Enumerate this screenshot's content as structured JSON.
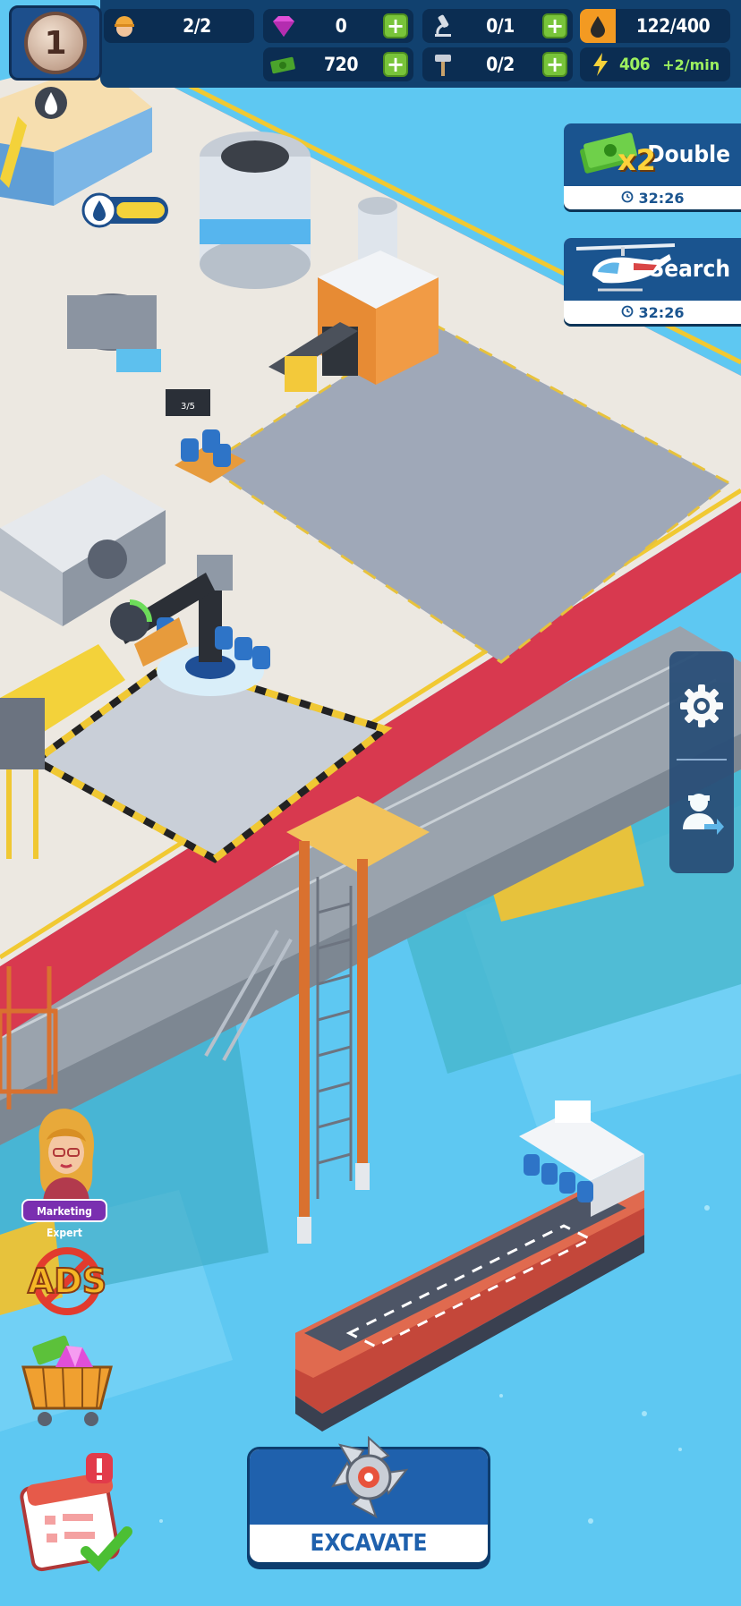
{
  "level": "1",
  "resources": {
    "workers": "2/2",
    "gems": "0",
    "research": "0/1",
    "oil": "122/400",
    "cash": "720",
    "tools": "0/2",
    "energy": "406",
    "energy_rate": "+2/min"
  },
  "boosts": {
    "double": {
      "badge": "x2",
      "label": "Double",
      "timer": "32:26"
    },
    "search": {
      "label": "Search",
      "timer": "32:26"
    }
  },
  "advisor": {
    "label": "Marketing Expert"
  },
  "ads_label": "ADS",
  "main_action": {
    "label": "EXCAVATE"
  },
  "colors": {
    "hud_bg": "#11416f",
    "accent_blue": "#1f61ad",
    "plus_green": "#78c43a",
    "water": "#5ec8f2"
  }
}
